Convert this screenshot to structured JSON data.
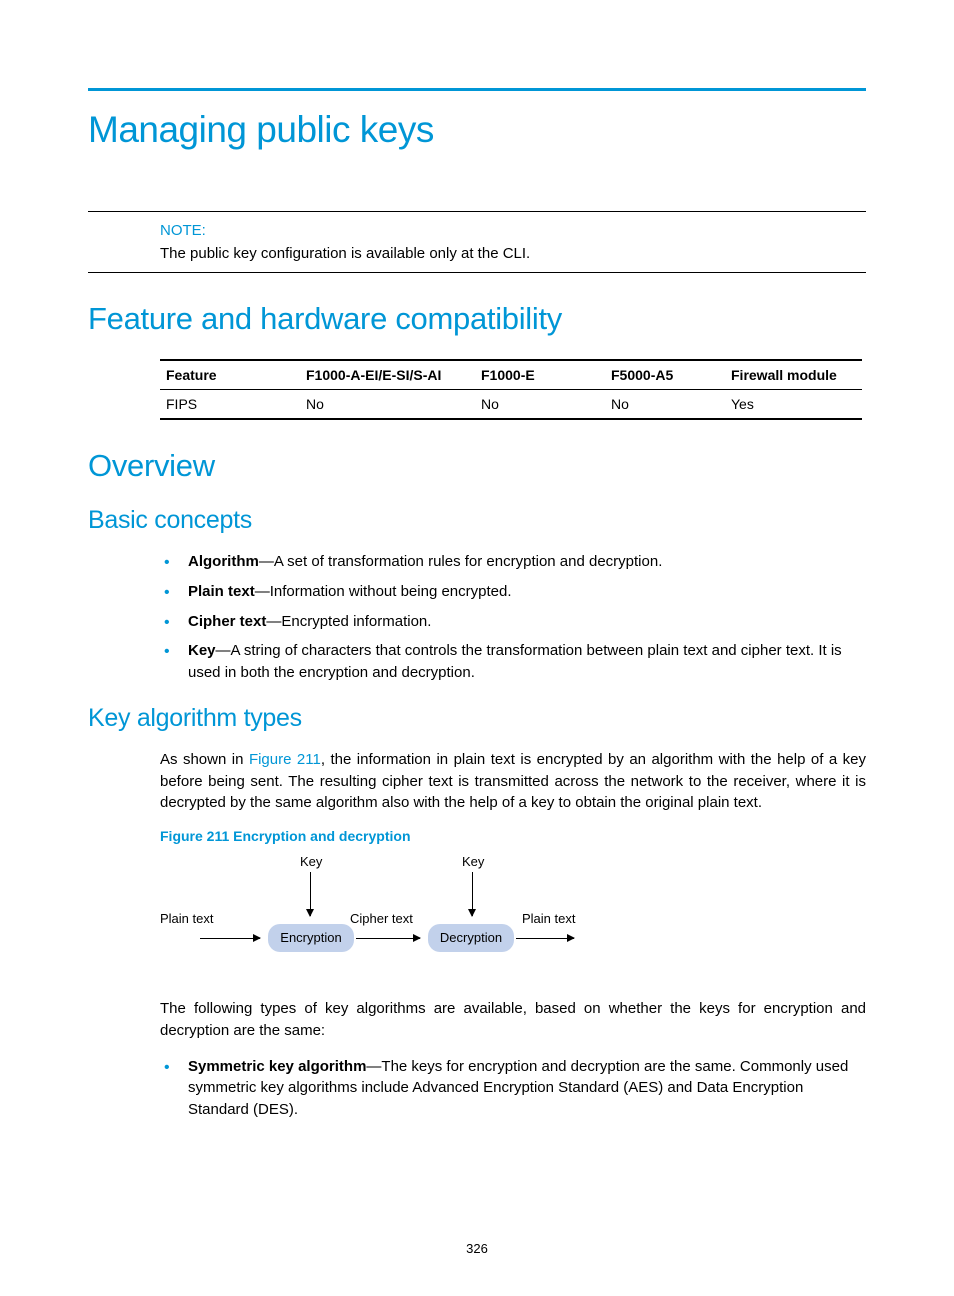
{
  "title": "Managing public keys",
  "note": {
    "label": "NOTE:",
    "text": "The public key configuration is available only at the CLI."
  },
  "section_feature": "Feature and hardware compatibility",
  "compat_table": {
    "headers": [
      "Feature",
      "F1000-A-EI/E-SI/S-AI",
      "F1000-E",
      "F5000-A5",
      "Firewall module"
    ],
    "row": [
      "FIPS",
      "No",
      "No",
      "No",
      "Yes"
    ]
  },
  "section_overview": "Overview",
  "sub_basic": "Basic concepts",
  "concepts": [
    {
      "term": "Algorithm",
      "def": "—A set of transformation rules for encryption and decryption."
    },
    {
      "term": "Plain text",
      "def": "—Information without being encrypted."
    },
    {
      "term": "Cipher text",
      "def": "—Encrypted information."
    },
    {
      "term": "Key",
      "def": "—A string of characters that controls the transformation between plain text and cipher text. It is used in both the encryption and decryption."
    }
  ],
  "sub_keyalg": "Key algorithm types",
  "para1_pre": "As shown in ",
  "para1_ref": "Figure 211",
  "para1_post": ", the information in plain text is encrypted by an algorithm with the help of a key before being sent. The resulting cipher text is transmitted across the network to the receiver, where it is decrypted by the same algorithm also with the help of a key to obtain the original plain text.",
  "fig_caption": "Figure 211 Encryption and decryption",
  "diagram": {
    "key1": "Key",
    "key2": "Key",
    "plain1": "Plain text",
    "plain2": "Plain text",
    "cipher": "Cipher text",
    "enc": "Encryption",
    "dec": "Decryption"
  },
  "para2": "The following types of key algorithms are available, based on whether the keys for encryption and decryption are the same:",
  "sym": {
    "term": "Symmetric key algorithm",
    "def": "—The keys for encryption and decryption are the same. Commonly used symmetric key algorithms include Advanced Encryption Standard (AES) and Data Encryption Standard (DES)."
  },
  "page_number": "326"
}
